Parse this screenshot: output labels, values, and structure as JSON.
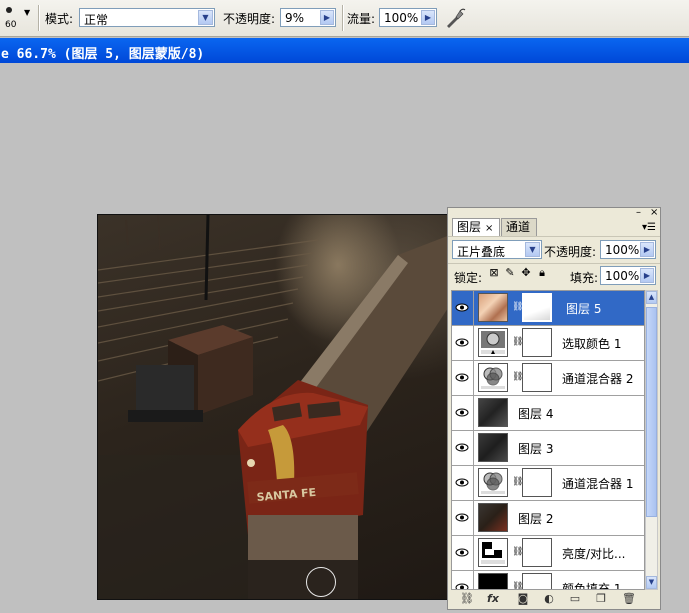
{
  "options_bar": {
    "brush_size": "60",
    "mode_label": "模式:",
    "mode_value": "正常",
    "opacity_label": "不透明度:",
    "opacity_value": "9%",
    "flow_label": "流量:",
    "flow_value": "100%"
  },
  "document": {
    "title": "e 66.7% (图层 5, 图层蒙版/8)"
  },
  "layers_panel": {
    "tabs": [
      "图层",
      "通道"
    ],
    "blend_mode": "正片叠底",
    "opacity_label": "不透明度:",
    "opacity_value": "100%",
    "lock_label": "锁定:",
    "fill_label": "填充:",
    "fill_value": "100%",
    "layers": [
      {
        "name": "图层 5",
        "selected": true,
        "thumb": "photo-warm",
        "mask": true
      },
      {
        "name": "选取颜色 1",
        "selected": false,
        "thumb": "selective-color-icon",
        "mask": true
      },
      {
        "name": "通道混合器 2",
        "selected": false,
        "thumb": "channel-mixer-icon",
        "mask": true
      },
      {
        "name": "图层 4",
        "selected": false,
        "thumb": "photo-dark",
        "mask": false
      },
      {
        "name": "图层 3",
        "selected": false,
        "thumb": "photo-dark",
        "mask": false
      },
      {
        "name": "通道混合器 1",
        "selected": false,
        "thumb": "channel-mixer-icon",
        "mask": true
      },
      {
        "name": "图层 2",
        "selected": false,
        "thumb": "photo-dark",
        "mask": false
      },
      {
        "name": "亮度/对比...",
        "selected": false,
        "thumb": "brightness-contrast-icon",
        "mask": true
      },
      {
        "name": "颜色填充 1",
        "selected": false,
        "thumb": "color-fill-black",
        "mask": true
      }
    ]
  },
  "colors": {
    "title_bar": "#0052e0",
    "selected_layer": "#3169c6",
    "workspace": "#c0c0c0"
  }
}
